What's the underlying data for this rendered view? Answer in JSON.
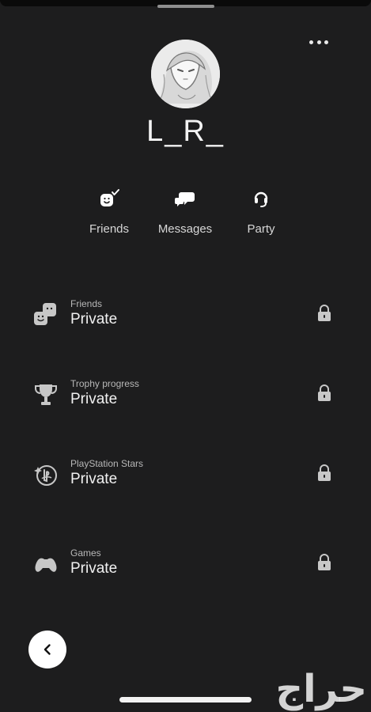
{
  "profile": {
    "username": "L_R_",
    "more_menu": "more-options"
  },
  "actions": [
    {
      "label": "Friends",
      "icon": "friend-added-icon"
    },
    {
      "label": "Messages",
      "icon": "messages-icon"
    },
    {
      "label": "Party",
      "icon": "party-headset-icon"
    }
  ],
  "privacy_rows": [
    {
      "title": "Friends",
      "value": "Private",
      "icon": "friends-icon"
    },
    {
      "title": "Trophy progress",
      "value": "Private",
      "icon": "trophy-icon"
    },
    {
      "title": "PlayStation Stars",
      "value": "Private",
      "icon": "playstation-stars-icon"
    },
    {
      "title": "Games",
      "value": "Private",
      "icon": "gamepad-icon"
    }
  ],
  "navigation": {
    "back": "back"
  },
  "watermark": {
    "text": "حراج"
  }
}
